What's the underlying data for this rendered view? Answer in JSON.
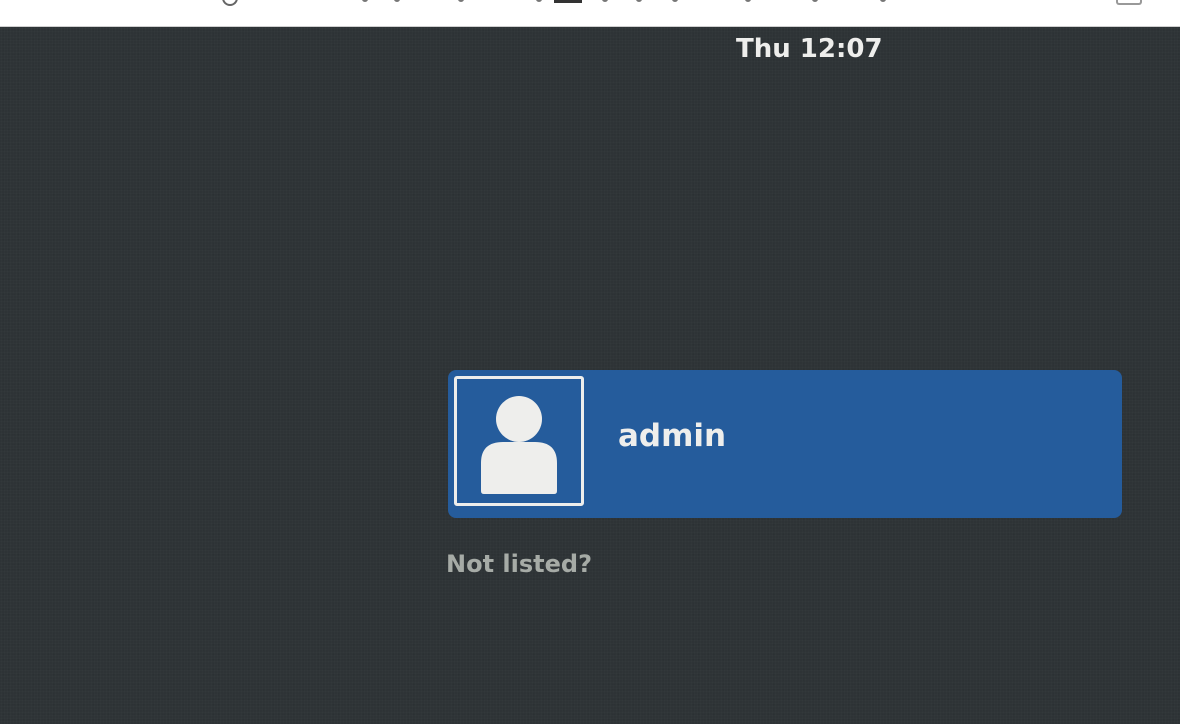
{
  "clock": {
    "text": "Thu 12:07"
  },
  "user_list": {
    "users": [
      {
        "name": "admin",
        "avatar_icon": "default-user-avatar-icon",
        "selected": true
      }
    ]
  },
  "not_listed": {
    "label": "Not listed?"
  },
  "colors": {
    "background": "#2e3336",
    "selected_row": "#255c9c",
    "primary_text": "#eeeeec",
    "secondary_text": "#a6aba6"
  }
}
